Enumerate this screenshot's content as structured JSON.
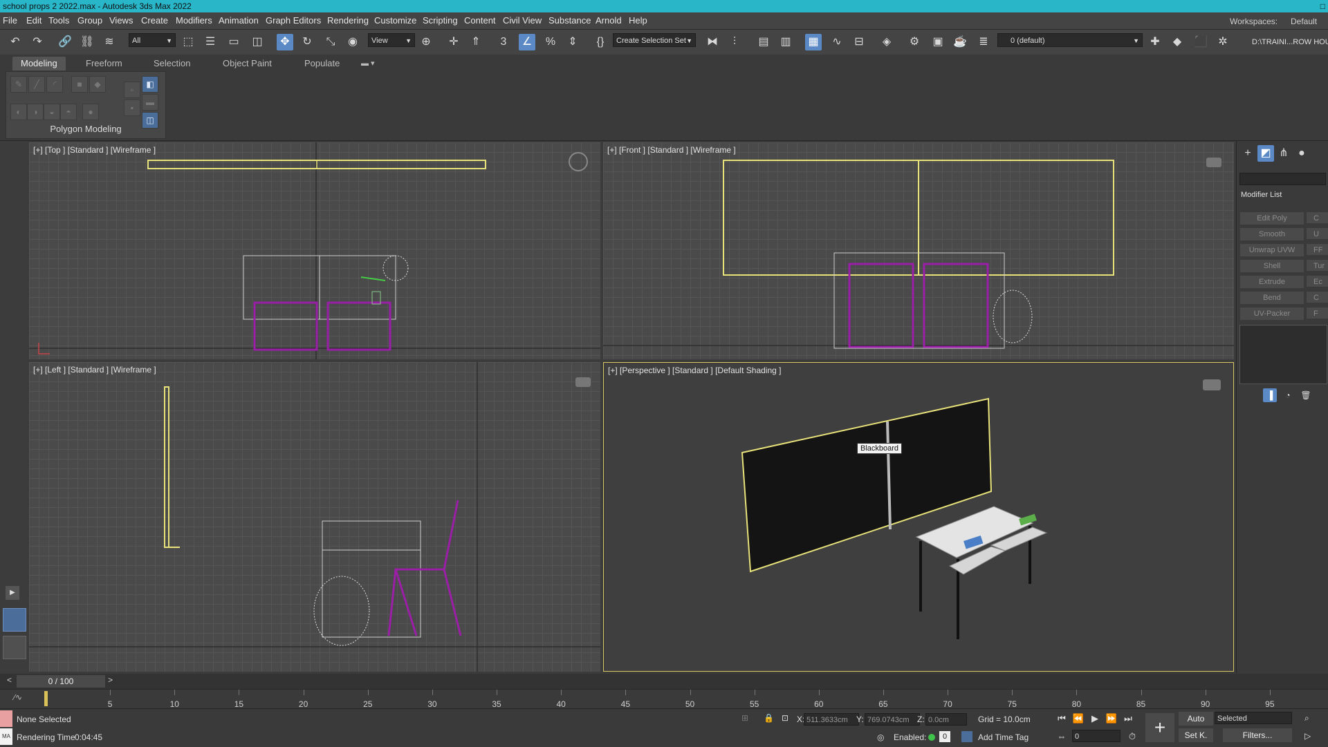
{
  "window": {
    "title": "school props 2 2022.max - Autodesk 3ds Max 2022",
    "close_glyph": "□"
  },
  "menu": {
    "items": [
      "File",
      "Edit",
      "Tools",
      "Group",
      "Views",
      "Create",
      "Modifiers",
      "Animation",
      "Graph Editors",
      "Rendering",
      "Customize",
      "Scripting",
      "Content",
      "Civil View",
      "Substance",
      "Arnold",
      "Help"
    ],
    "workspaces_label": "Workspaces:",
    "workspaces_value": "Default"
  },
  "toolbar": {
    "filter_value": "All",
    "refcoord_value": "View",
    "angle_snap_label": "3",
    "selection_set_value": "Create Selection Set",
    "layer_value": "0 (default)",
    "project_path": "D:\\TRAINI...ROW HOU"
  },
  "ribbon": {
    "tabs": [
      "Modeling",
      "Freeform",
      "Selection",
      "Object Paint",
      "Populate"
    ],
    "active_tab": "Modeling",
    "panel_label": "Polygon Modeling"
  },
  "viewports": {
    "top": "[+] [Top ] [Standard ] [Wireframe ]",
    "front": "[+] [Front ] [Standard ] [Wireframe ]",
    "left": "[+] [Left ] [Standard ] [Wireframe ]",
    "perspective": "[+] [Perspective ] [Standard ] [Default Shading ]",
    "tooltip": "Blackboard"
  },
  "command_panel": {
    "modifier_list_label": "Modifier List",
    "modifier_buttons": [
      "Edit Poly",
      "Smooth",
      "Unwrap UVW",
      "Shell",
      "Extrude",
      "Bend",
      "UV-Packer"
    ],
    "modifier_buttons_right": [
      "C",
      "U",
      "FF",
      "Tur",
      "Ec",
      "C",
      "F"
    ]
  },
  "timeline": {
    "slider_text": "0 / 100",
    "ticks": [
      "5",
      "10",
      "15",
      "20",
      "25",
      "30",
      "35",
      "40",
      "45",
      "50",
      "55",
      "60",
      "65",
      "70",
      "75",
      "80",
      "85",
      "90",
      "95"
    ],
    "tick_values": [
      5,
      10,
      15,
      20,
      25,
      30,
      35,
      40,
      45,
      50,
      55,
      60,
      65,
      70,
      75,
      80,
      85,
      90,
      95
    ],
    "range": [
      0,
      100
    ]
  },
  "status": {
    "selection": "None Selected",
    "render_time_label": "Rendering Time",
    "render_time": "0:04:45",
    "maxscript_label": "MA",
    "x_label": "X:",
    "x_value": "511.3633cm",
    "y_label": "Y:",
    "y_value": "769.0743cm",
    "z_label": "Z:",
    "z_value": "0.0cm",
    "grid": "Grid = 10.0cm",
    "enabled_label": "Enabled:",
    "enabled_value": "0",
    "add_time_tag": "Add Time Tag",
    "auto_label": "Auto",
    "setk_label": "Set K.",
    "selected_value": "Selected",
    "filters_label": "Filters...",
    "frame_value": "0"
  },
  "colors": {
    "title_accent": "#29b6c8",
    "selection_yellow": "#e8e27a",
    "wire_magenta": "#9a1fa6",
    "active_blue": "#5a89c6"
  }
}
